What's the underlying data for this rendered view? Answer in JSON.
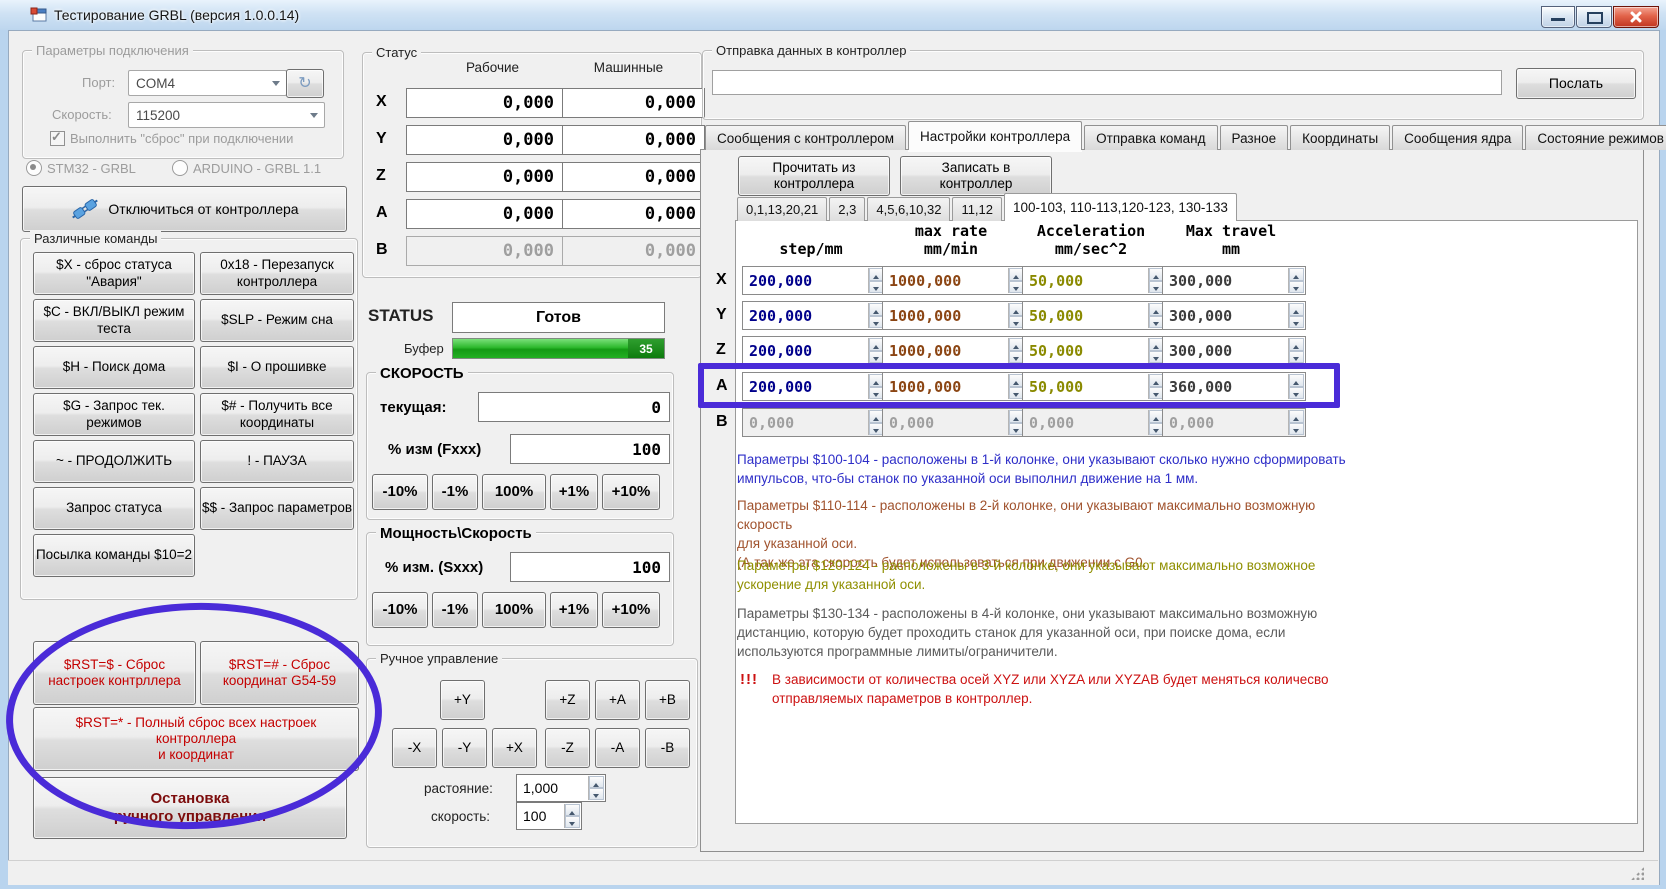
{
  "window": {
    "title": "Тестирование GRBL (версия 1.0.0.14)"
  },
  "connection": {
    "group_title": "Параметры подключения",
    "port_label": "Порт:",
    "port_value": "COM4",
    "speed_label": "Скорость:",
    "speed_value": "115200",
    "reset_checkbox_label": "Выполнить \"сброс\" при подключении",
    "radio_stm32": "STM32 - GRBL",
    "radio_arduino": "ARDUINO - GRBL 1.1",
    "disconnect_button": "Отключиться от контроллера"
  },
  "commands": {
    "group_title": "Различные команды",
    "buttons": [
      "$X - сброс статуса \"Авария\"",
      "0x18 - Перезапуск контроллера",
      "$C - ВКЛ/ВЫКЛ режим теста",
      "$SLP - Режим сна",
      "$H - Поиск дома",
      "$I - О прошивке",
      "$G - Запрос тек. режимов",
      "$# - Получить все координаты",
      "~ - ПРОДОЛЖИТЬ",
      "! - ПАУЗА",
      "Запрос статуса",
      "$$ - Запрос параметров"
    ],
    "send_10_button": "Посылка команды $10=2",
    "rst_settings_button": "$RST=$ - Сброс настроек контрллера",
    "rst_coords_button": "$RST=# - Сброс координат G54-59",
    "rst_all_button": "$RST=* - Полный сброс всех настроек\nконтроллера\nи координат",
    "stop_manual_button": "Остановка\nручного управления"
  },
  "status": {
    "group_title": "Статус",
    "col_working": "Рабочие",
    "col_machine": "Машинные",
    "axes": [
      {
        "axis": "X",
        "working": "0,000",
        "machine": "0,000"
      },
      {
        "axis": "Y",
        "working": "0,000",
        "machine": "0,000"
      },
      {
        "axis": "Z",
        "working": "0,000",
        "machine": "0,000"
      },
      {
        "axis": "A",
        "working": "0,000",
        "machine": "0,000"
      },
      {
        "axis": "B",
        "working": "0,000",
        "machine": "0,000"
      }
    ],
    "status_label": "STATUS",
    "status_value": "Готов",
    "buffer_label": "Буфер",
    "buffer_value": "35"
  },
  "feed": {
    "group_title": "СКОРОСТЬ",
    "current_label": "текущая:",
    "current_value": "0",
    "percent_label": "% изм (Fxxx)",
    "percent_value": "100",
    "buttons": [
      "-10%",
      "-1%",
      "100%",
      "+1%",
      "+10%"
    ]
  },
  "power": {
    "group_title": "Мощность\\Скорость",
    "percent_label": "% изм. (Sxxx)",
    "percent_value": "100",
    "buttons": [
      "-10%",
      "-1%",
      "100%",
      "+1%",
      "+10%"
    ]
  },
  "jog": {
    "group_title": "Ручное управление",
    "row1": [
      "+Y",
      "+Z",
      "+A",
      "+B"
    ],
    "row2": [
      "-X",
      "-Y",
      "+X",
      "-Z",
      "-A",
      "-B"
    ],
    "distance_label": "растояние:",
    "distance_value": "1,000",
    "speed_label": "скорость:",
    "speed_value": "100"
  },
  "send": {
    "group_title": "Отправка данных в контроллер",
    "input_value": "",
    "send_button": "Послать"
  },
  "tabs": [
    "Сообщения с контроллером",
    "Настройки контроллера",
    "Отправка команд",
    "Разное",
    "Координаты",
    "Сообщения ядра",
    "Состояние режимов"
  ],
  "settings": {
    "read_button": "Прочитать из\nконтроллера",
    "write_button": "Записать в\nконтроллер",
    "subtabs": [
      "0,1,13,20,21",
      "2,3",
      "4,5,6,10,32",
      "11,12",
      "100-103, 110-113,120-123, 130-133"
    ],
    "table": {
      "headers": [
        "step/mm",
        "max rate\nmm/min",
        "Acceleration\nmm/sec^2",
        "Max travel\nmm"
      ],
      "rows": [
        {
          "axis": "X",
          "values": [
            "200,000",
            "1000,000",
            "50,000",
            "300,000"
          ]
        },
        {
          "axis": "Y",
          "values": [
            "200,000",
            "1000,000",
            "50,000",
            "300,000"
          ]
        },
        {
          "axis": "Z",
          "values": [
            "200,000",
            "1000,000",
            "50,000",
            "300,000"
          ]
        },
        {
          "axis": "A",
          "values": [
            "200,000",
            "1000,000",
            "50,000",
            "360,000"
          ]
        },
        {
          "axis": "B",
          "values": [
            "0,000",
            "0,000",
            "0,000",
            "0,000"
          ]
        }
      ]
    },
    "notes": [
      "Параметры $100-104 - расположены в 1-й колонке, они указывают сколько нужно сформировать\nимпульсов, что-бы станок по указанной оси выполнил движение на 1 мм.",
      "Параметры $110-114 - расположены в 2-й колонке, они указывают максимально возможную скорость\nдля указанной оси.\n(А так-же эта скорость будет использоваться при движении с G0.",
      "Параметры $120-124 - расположены в 3-й колонке, они указывают максимально возможное\nускорение для указанной оси.",
      "Параметры $130-134 - расположены в 4-й колонке, они указывают максимально возможную\nдистанцию, которую будет проходить станок для указанной оси, при поиске дома, если\nиспользуются программные лимиты/ограничители."
    ],
    "warning_bang": "!!!",
    "warning_text": "В зависимости от количества осей XYZ или XYZA или XYZAB будет меняться количесво\nотправляемых параметров в контроллер."
  },
  "colors": {
    "annotation_purple": "#4a2bd8",
    "buffer_green": "#2db82d",
    "value_navy": "#00008b",
    "value_brown": "#8b4513",
    "value_olive": "#8a8a00",
    "value_dark": "#3c3c3c",
    "warning_red": "#cc1111"
  }
}
